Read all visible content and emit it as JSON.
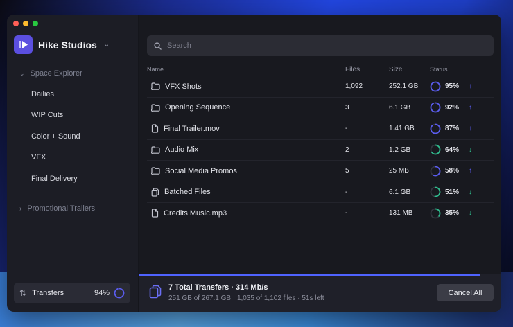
{
  "workspace": {
    "name": "Hike Studios"
  },
  "sidebar": {
    "group_open": "Space Explorer",
    "items": [
      "Dailies",
      "WIP Cuts",
      "Color + Sound",
      "VFX",
      "Final Delivery"
    ],
    "group_closed": "Promotional Trailers"
  },
  "transfers_widget": {
    "label": "Transfers",
    "percent": "94%",
    "progress": 0.94
  },
  "search": {
    "placeholder": "Search"
  },
  "table": {
    "headers": {
      "name": "Name",
      "files": "Files",
      "size": "Size",
      "status": "Status"
    },
    "rows": [
      {
        "type": "folder",
        "name": "VFX Shots",
        "files": "1,092",
        "size": "252.1 GB",
        "pct": "95%",
        "progress": 0.95,
        "direction": "upload"
      },
      {
        "type": "folder",
        "name": "Opening Sequence",
        "files": "3",
        "size": "6.1 GB",
        "pct": "92%",
        "progress": 0.92,
        "direction": "upload"
      },
      {
        "type": "file",
        "name": "Final Trailer.mov",
        "files": "-",
        "size": "1.41 GB",
        "pct": "87%",
        "progress": 0.87,
        "direction": "upload"
      },
      {
        "type": "folder",
        "name": "Audio Mix",
        "files": "2",
        "size": "1.2 GB",
        "pct": "64%",
        "progress": 0.64,
        "direction": "download"
      },
      {
        "type": "folder",
        "name": "Social Media Promos",
        "files": "5",
        "size": "25 MB",
        "pct": "58%",
        "progress": 0.58,
        "direction": "upload"
      },
      {
        "type": "files",
        "name": "Batched Files",
        "files": "-",
        "size": "6.1 GB",
        "pct": "51%",
        "progress": 0.51,
        "direction": "download"
      },
      {
        "type": "file",
        "name": "Credits Music.mp3",
        "files": "-",
        "size": "131 MB",
        "pct": "35%",
        "progress": 0.35,
        "direction": "download"
      }
    ]
  },
  "footer": {
    "title": "7 Total Transfers · 314 Mb/s",
    "subtitle": "251 GB of 267.1 GB · 1,035 of 1,102 files · 51s left",
    "progress": 0.94,
    "cancel_label": "Cancel All"
  },
  "colors": {
    "upload": "#5a5cf0",
    "download": "#2fbf8f",
    "accent": "#4f63ff"
  }
}
